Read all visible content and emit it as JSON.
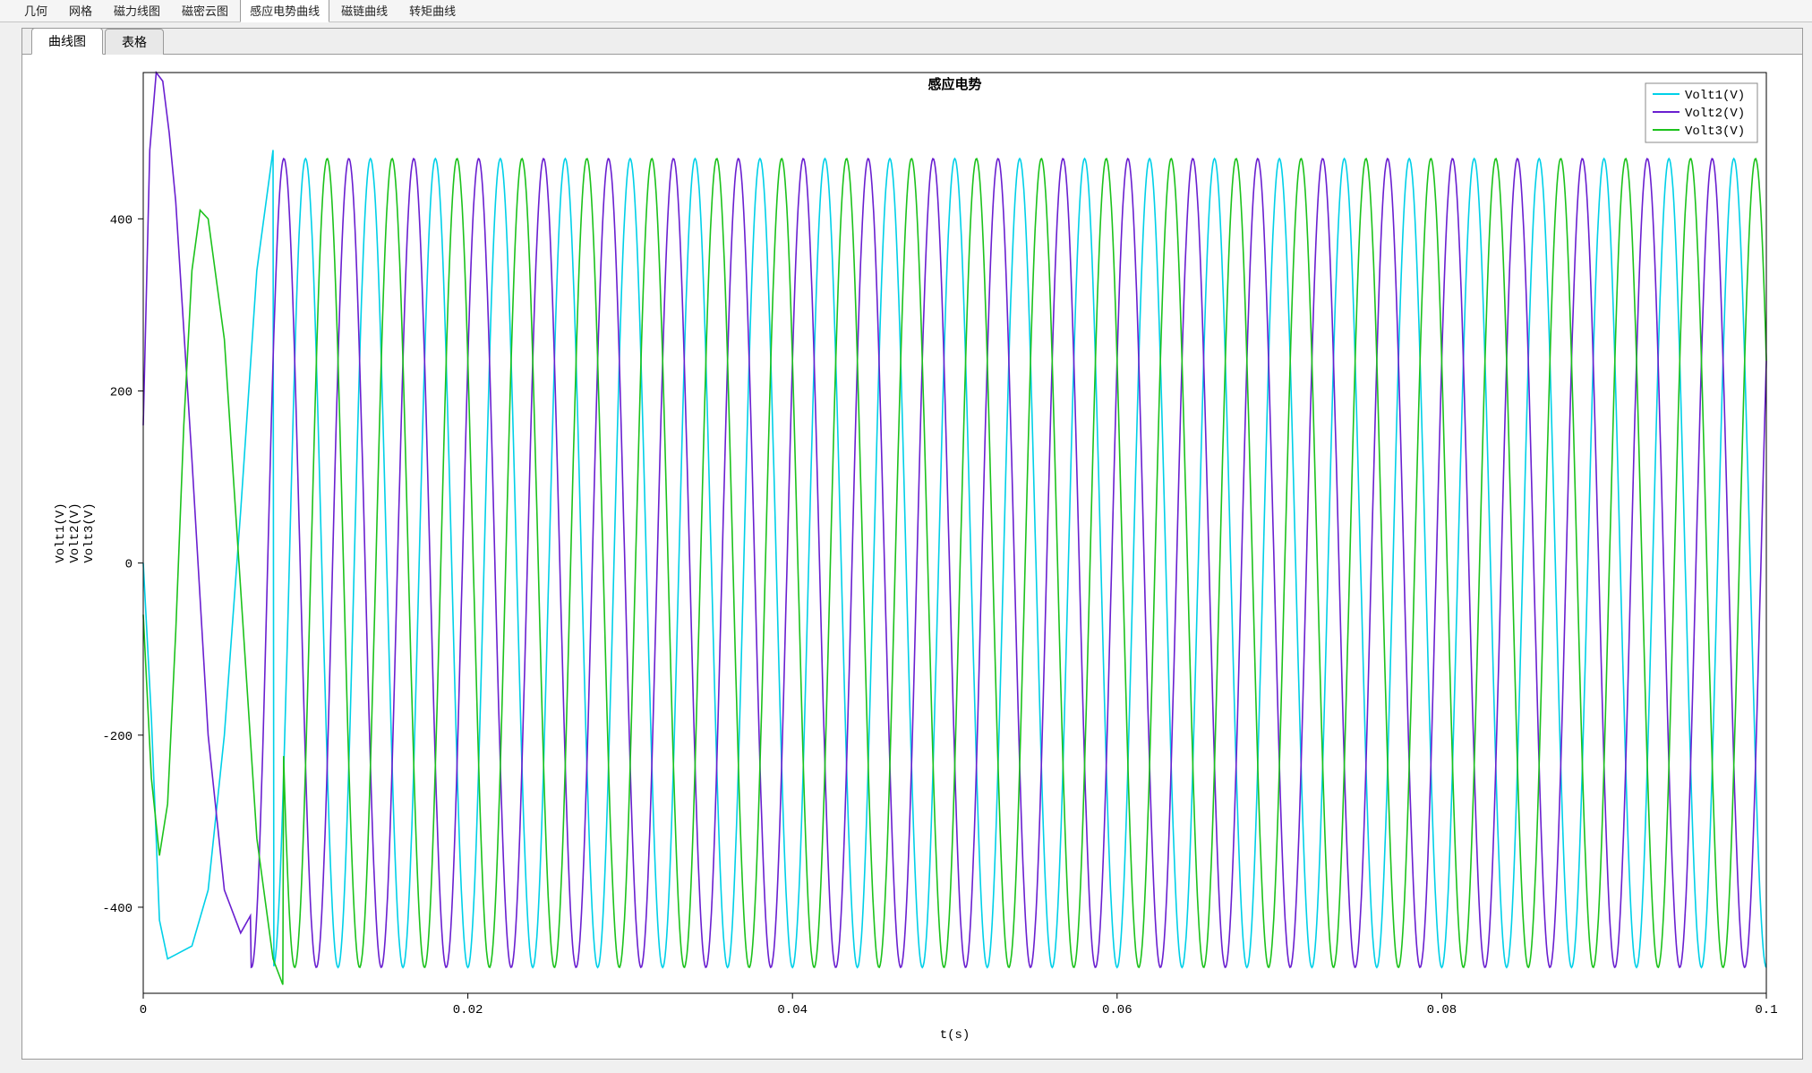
{
  "top_tabs": {
    "items": [
      {
        "label": "几何"
      },
      {
        "label": "网格"
      },
      {
        "label": "磁力线图"
      },
      {
        "label": "磁密云图"
      },
      {
        "label": "感应电势曲线",
        "active": true
      },
      {
        "label": "磁链曲线"
      },
      {
        "label": "转矩曲线"
      }
    ]
  },
  "sub_tabs": {
    "items": [
      {
        "label": "曲线图",
        "active": true
      },
      {
        "label": "表格"
      }
    ]
  },
  "chart_data": {
    "type": "line",
    "title": "感应电势",
    "xlabel": "t(s)",
    "ylabel": "Volt1(V)\nVolt2(V)\nVolt3(V)",
    "ylabels": [
      "Volt1(V)",
      "Volt2(V)",
      "Volt3(V)"
    ],
    "xlim": [
      0,
      0.1
    ],
    "ylim": [
      -500,
      570
    ],
    "xticks": [
      0,
      0.02,
      0.04,
      0.06,
      0.08,
      0.1
    ],
    "yticks": [
      -400,
      -200,
      0,
      200,
      400
    ],
    "legend_pos": "top-right",
    "series": [
      {
        "name": "Volt1(V)",
        "color": "#00d0e8",
        "freq": 250,
        "amp": 470,
        "phase_deg": -90,
        "start_transient": [
          [
            0,
            0
          ],
          [
            0.0005,
            -180
          ],
          [
            0.001,
            -415
          ],
          [
            0.0015,
            -460
          ],
          [
            0.002,
            -455
          ],
          [
            0.003,
            -445
          ],
          [
            0.004,
            -380
          ],
          [
            0.005,
            -200
          ],
          [
            0.006,
            60
          ],
          [
            0.007,
            340
          ],
          [
            0.008,
            480
          ]
        ]
      },
      {
        "name": "Volt2(V)",
        "color": "#6a1fd0",
        "freq": 250,
        "amp": 470,
        "phase_deg": 30,
        "start_transient": [
          [
            0,
            160
          ],
          [
            0.0004,
            480
          ],
          [
            0.0008,
            570
          ],
          [
            0.0012,
            560
          ],
          [
            0.0016,
            500
          ],
          [
            0.002,
            420
          ],
          [
            0.003,
            120
          ],
          [
            0.004,
            -200
          ],
          [
            0.005,
            -380
          ],
          [
            0.006,
            -430
          ],
          [
            0.0066,
            -410
          ]
        ]
      },
      {
        "name": "Volt3(V)",
        "color": "#1cc21c",
        "freq": 250,
        "amp": 470,
        "phase_deg": 150,
        "start_transient": [
          [
            0,
            -60
          ],
          [
            0.0005,
            -250
          ],
          [
            0.001,
            -340
          ],
          [
            0.0015,
            -280
          ],
          [
            0.002,
            -80
          ],
          [
            0.0025,
            160
          ],
          [
            0.003,
            340
          ],
          [
            0.0035,
            410
          ],
          [
            0.004,
            400
          ],
          [
            0.005,
            260
          ],
          [
            0.006,
            -30
          ],
          [
            0.007,
            -320
          ],
          [
            0.008,
            -460
          ],
          [
            0.0086,
            -490
          ]
        ]
      }
    ]
  }
}
